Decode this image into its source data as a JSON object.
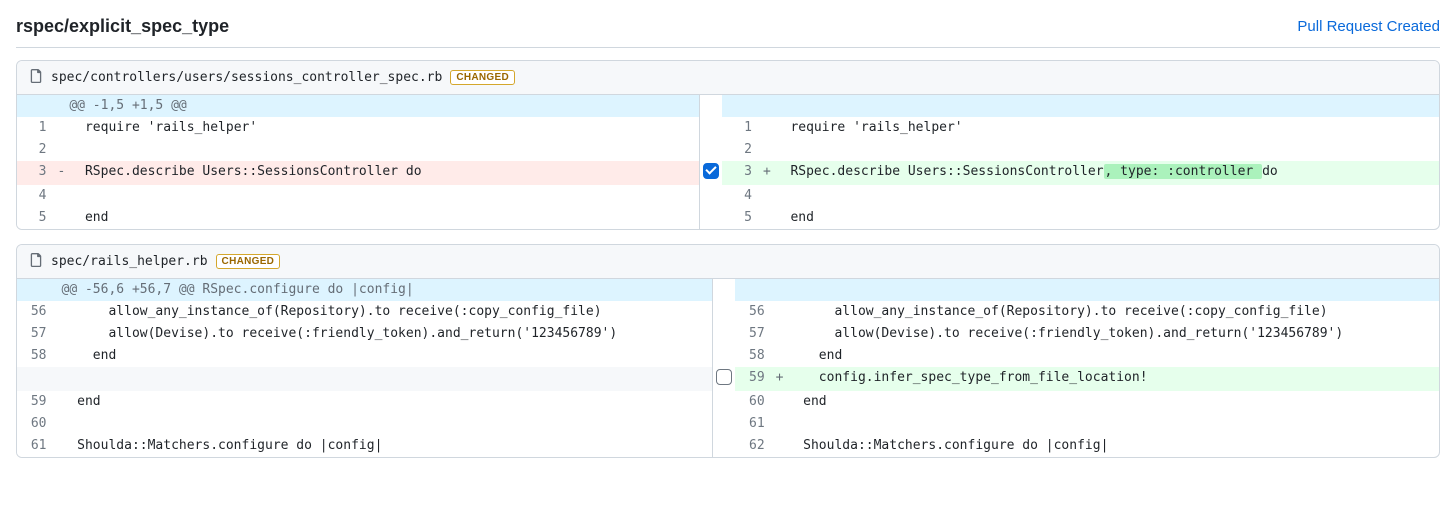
{
  "header": {
    "title": "rspec/explicit_spec_type",
    "pull_request_link": "Pull Request Created"
  },
  "badge_changed": "CHANGED",
  "files": [
    {
      "path": "spec/controllers/users/sessions_controller_spec.rb",
      "hunk": "@@ -1,5 +1,5 @@",
      "rows": [
        {
          "type": "hunk",
          "lnum": "",
          "rnum": "",
          "lsign": "",
          "rsign": "",
          "ltext": "@@ -1,5 +1,5 @@",
          "rtext": "",
          "check": null
        },
        {
          "type": "ctx",
          "lnum": "1",
          "rnum": "1",
          "lsign": "",
          "rsign": "",
          "ltext": "  require 'rails_helper'",
          "rtext": "  require 'rails_helper'",
          "check": null
        },
        {
          "type": "ctx",
          "lnum": "2",
          "rnum": "2",
          "lsign": "",
          "rsign": "",
          "ltext": "",
          "rtext": "",
          "check": null
        },
        {
          "type": "chg",
          "lnum": "3",
          "rnum": "3",
          "lsign": "-",
          "rsign": "+",
          "ltext": "  RSpec.describe Users::SessionsController do",
          "rtext_parts": [
            {
              "t": "  RSpec.describe Users::SessionsController"
            },
            {
              "t": ", type: :controller ",
              "hl": true
            },
            {
              "t": "do"
            }
          ],
          "check": true
        },
        {
          "type": "ctx",
          "lnum": "4",
          "rnum": "4",
          "lsign": "",
          "rsign": "",
          "ltext": "",
          "rtext": "",
          "check": null
        },
        {
          "type": "ctx",
          "lnum": "5",
          "rnum": "5",
          "lsign": "",
          "rsign": "",
          "ltext": "  end",
          "rtext": "  end",
          "check": null
        }
      ]
    },
    {
      "path": "spec/rails_helper.rb",
      "hunk": "@@ -56,6 +56,7 @@ RSpec.configure do |config|",
      "rows": [
        {
          "type": "hunk",
          "lnum": "",
          "rnum": "",
          "lsign": "",
          "rsign": "",
          "ltext": "@@ -56,6 +56,7 @@ RSpec.configure do |config|",
          "rtext": "",
          "check": null
        },
        {
          "type": "ctx",
          "lnum": "56",
          "rnum": "56",
          "lsign": "",
          "rsign": "",
          "ltext": "      allow_any_instance_of(Repository).to receive(:copy_config_file)",
          "rtext": "      allow_any_instance_of(Repository).to receive(:copy_config_file)",
          "check": null
        },
        {
          "type": "ctx",
          "lnum": "57",
          "rnum": "57",
          "lsign": "",
          "rsign": "",
          "ltext": "      allow(Devise).to receive(:friendly_token).and_return('123456789')",
          "rtext": "      allow(Devise).to receive(:friendly_token).and_return('123456789')",
          "check": null
        },
        {
          "type": "ctx",
          "lnum": "58",
          "rnum": "58",
          "lsign": "",
          "rsign": "",
          "ltext": "    end",
          "rtext": "    end",
          "check": null
        },
        {
          "type": "addonly",
          "lnum": "",
          "rnum": "59",
          "lsign": "",
          "rsign": "+",
          "ltext": "",
          "rtext": "    config.infer_spec_type_from_file_location!",
          "check": false
        },
        {
          "type": "ctx",
          "lnum": "59",
          "rnum": "60",
          "lsign": "",
          "rsign": "",
          "ltext": "  end",
          "rtext": "  end",
          "check": null
        },
        {
          "type": "ctx",
          "lnum": "60",
          "rnum": "61",
          "lsign": "",
          "rsign": "",
          "ltext": "",
          "rtext": "",
          "check": null
        },
        {
          "type": "ctx",
          "lnum": "61",
          "rnum": "62",
          "lsign": "",
          "rsign": "",
          "ltext": "  Shoulda::Matchers.configure do |config|",
          "rtext": "  Shoulda::Matchers.configure do |config|",
          "check": null
        }
      ]
    }
  ]
}
